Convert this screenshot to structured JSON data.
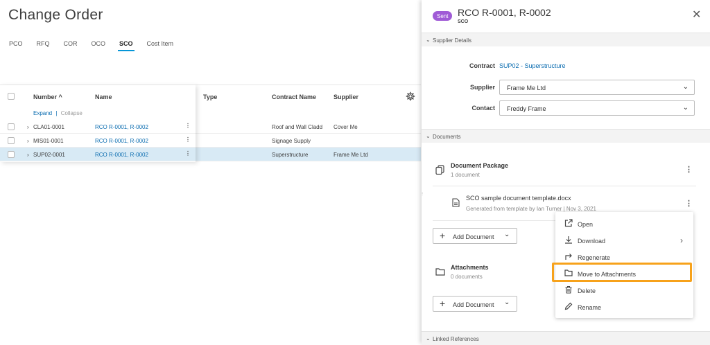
{
  "page": {
    "title": "Change Order"
  },
  "tabs": [
    {
      "label": "PCO"
    },
    {
      "label": "RFQ"
    },
    {
      "label": "COR"
    },
    {
      "label": "OCO"
    },
    {
      "label": "SCO"
    },
    {
      "label": "Cost Item"
    }
  ],
  "table": {
    "columns": {
      "number": "Number ^",
      "name": "Name",
      "type": "Type",
      "contract_name": "Contract Name",
      "supplier": "Supplier"
    },
    "expand": "Expand",
    "separator": "|",
    "collapse": "Collapse",
    "rows": [
      {
        "number": "CLA01-0001",
        "name": "RCO R-0001, R-0002",
        "type": "",
        "contract_name": "Roof and Wall Cladding",
        "supplier": "Cover Me"
      },
      {
        "number": "MIS01-0001",
        "name": "RCO R-0001, R-0002",
        "type": "",
        "contract_name": "Signage Supply",
        "supplier": ""
      },
      {
        "number": "SUP02-0001",
        "name": "RCO R-0001, R-0002",
        "type": "",
        "contract_name": "Superstructure",
        "supplier": "Frame Me Ltd"
      }
    ]
  },
  "panel": {
    "badge": "Sent",
    "title": "RCO R-0001, R-0002",
    "subtitle": "SCO",
    "sections": {
      "supplier_details": "Supplier Details",
      "documents": "Documents",
      "linked_references": "Linked References"
    },
    "contract_label": "Contract",
    "contract_value": "SUP02 - Superstructure",
    "supplier_label": "Supplier",
    "supplier_value": "Frame Me Ltd",
    "contact_label": "Contact",
    "contact_value": "Freddy Frame",
    "package_title": "Document Package",
    "package_count": "1 document",
    "doc_name": "SCO sample document template.docx",
    "doc_meta": "Generated from template by Ian Turner | Nov 3, 2021",
    "add_document": "Add Document",
    "attachments_title": "Attachments",
    "attachments_count": "0 documents"
  },
  "menu": {
    "items": [
      {
        "label": "Open",
        "icon": "open-external-icon"
      },
      {
        "label": "Download",
        "icon": "download-icon"
      },
      {
        "label": "Regenerate",
        "icon": "regenerate-icon"
      },
      {
        "label": "Move to Attachments",
        "icon": "folder-icon"
      },
      {
        "label": "Delete",
        "icon": "trash-icon"
      },
      {
        "label": "Rename",
        "icon": "pencil-icon"
      }
    ]
  },
  "colors": {
    "accent": "#0696d7",
    "badge": "#a05bd6",
    "highlight": "#f7a21b",
    "selected_row": "#d8eaf5",
    "link": "#0a6cb0"
  }
}
